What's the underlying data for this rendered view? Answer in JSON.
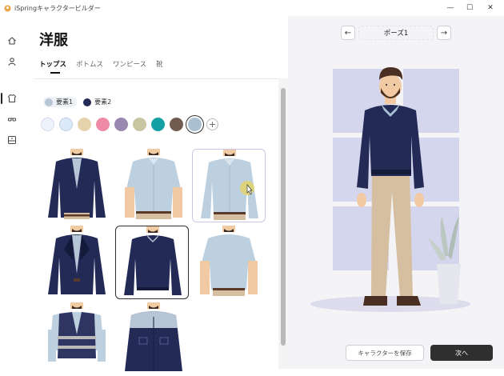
{
  "window": {
    "title": "iSpringキャラクタービルダー",
    "minimize_label": "—",
    "maximize_label": "☐",
    "close_label": "✕"
  },
  "sidebar": {
    "items": [
      {
        "icon": "home-icon"
      },
      {
        "icon": "person-icon"
      },
      {
        "icon": "shirt-icon",
        "active": true
      },
      {
        "icon": "glasses-icon"
      },
      {
        "icon": "frame-icon"
      }
    ]
  },
  "page": {
    "title": "洋服"
  },
  "tabs": [
    {
      "label": "トップス",
      "active": true
    },
    {
      "label": "ボトムス"
    },
    {
      "label": "ワンピース"
    },
    {
      "label": "靴"
    }
  ],
  "color_elements": [
    {
      "label": "要素1",
      "color": "#b7c6d6",
      "selected": true
    },
    {
      "label": "要素2",
      "color": "#232a55"
    }
  ],
  "swatches": [
    {
      "color": "#eef2fb",
      "name": "white-dotted"
    },
    {
      "color": "#dbe9f8",
      "name": "light-blue-dotted"
    },
    {
      "color": "#e5d3ae",
      "name": "beige"
    },
    {
      "color": "#ee8aa6",
      "name": "pink"
    },
    {
      "color": "#9b88b0",
      "name": "lavender"
    },
    {
      "color": "#c8c6a0",
      "name": "olive-pattern"
    },
    {
      "color": "#13a1a5",
      "name": "teal"
    },
    {
      "color": "#6f5c4e",
      "name": "brown"
    },
    {
      "color": "#a9c0d3",
      "name": "light-steel-blue",
      "selected": true
    }
  ],
  "swatch_add_label": "+",
  "garments": [
    {
      "name": "navy-cardigan"
    },
    {
      "name": "light-blue-shirt-short-sleeve"
    },
    {
      "name": "light-blue-shirt-long-sleeve"
    },
    {
      "name": "navy-blazer"
    },
    {
      "name": "navy-sweater"
    },
    {
      "name": "light-blue-tshirt"
    },
    {
      "name": "safety-vest"
    },
    {
      "name": "navy-work-jacket"
    }
  ],
  "preview": {
    "pose_label": "ポーズ1",
    "prev_label": "←",
    "next_label": "→",
    "colors": {
      "sweater": "#232a55",
      "collar": "#a9c0d3",
      "pants": "#d6bfa1",
      "shoes": "#4a2e22",
      "skin": "#f1c9a3",
      "hair": "#4b2f22",
      "window": "#d4d6ee",
      "floor": "#dcdcec"
    }
  },
  "footer": {
    "save_label": "キャラクターを保存",
    "next_label": "次へ"
  }
}
